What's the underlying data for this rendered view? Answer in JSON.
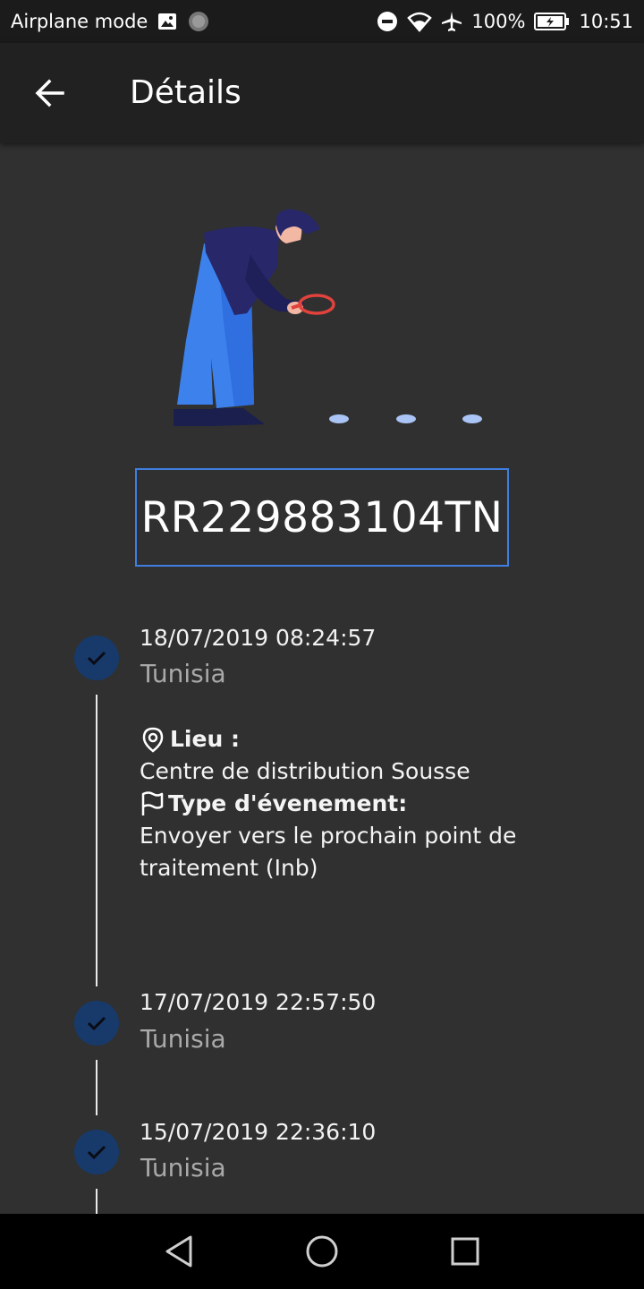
{
  "status_bar": {
    "left_text": "Airplane mode",
    "battery": "100%",
    "time": "10:51",
    "icons": [
      "image-icon",
      "circle-icon",
      "do-not-disturb-icon",
      "wifi-icon",
      "airplane-icon",
      "battery-charging-icon"
    ]
  },
  "app_bar": {
    "title": "Détails",
    "back_icon": "arrow-left-icon"
  },
  "tracking_number": "RR229883104TN",
  "events": [
    {
      "date": "18/07/2019 08:24:57",
      "country": "Tunisia",
      "location_label": "Lieu :",
      "location": "Centre de distribution Sousse",
      "event_type_label": "Type d'évenement:",
      "event_type": "Envoyer vers le prochain point de traitement (Inb)"
    },
    {
      "date": "17/07/2019 22:57:50",
      "country": "Tunisia"
    },
    {
      "date": "15/07/2019 22:36:10",
      "country": "Tunisia"
    }
  ],
  "colors": {
    "background": "#303030",
    "app_bar": "#212121",
    "accent": "#3f7ee0",
    "check_circle": "#173a6b"
  },
  "nav_bar": {
    "icons": [
      "back-triangle-icon",
      "home-circle-icon",
      "recents-square-icon"
    ]
  }
}
